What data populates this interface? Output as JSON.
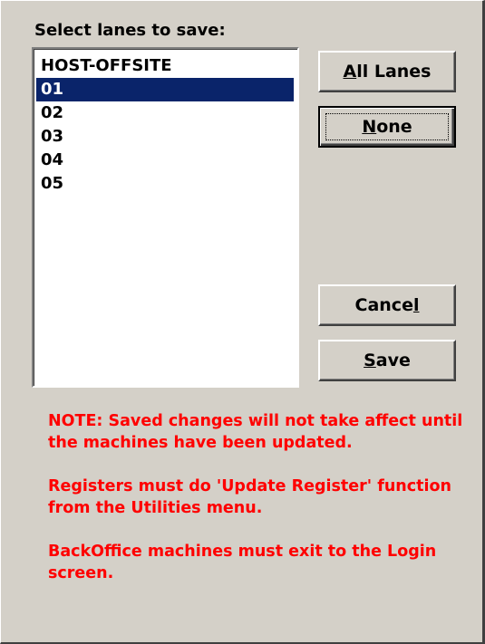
{
  "dialog": {
    "list_label": "Select lanes to save:",
    "lanes": [
      {
        "label": "HOST-OFFSITE",
        "selected": false
      },
      {
        "label": "01",
        "selected": true
      },
      {
        "label": "02",
        "selected": false
      },
      {
        "label": "03",
        "selected": false
      },
      {
        "label": "04",
        "selected": false
      },
      {
        "label": "05",
        "selected": false
      }
    ],
    "buttons": {
      "all_lanes": {
        "mnemonic": "A",
        "rest": "ll Lanes"
      },
      "none": {
        "mnemonic": "N",
        "rest": "one"
      },
      "cancel": {
        "before": "Cance",
        "mnemonic": "l"
      },
      "save": {
        "mnemonic": "S",
        "rest": "ave"
      }
    },
    "notes": [
      "NOTE: Saved changes will not take affect until the machines have been updated.",
      "Registers must do 'Update Register' function from the Utilities menu.",
      "BackOffice machines must exit to the Login screen."
    ]
  },
  "colors": {
    "background": "#d4d0c8",
    "selection": "#0a246a",
    "note_text": "#ff0000"
  }
}
